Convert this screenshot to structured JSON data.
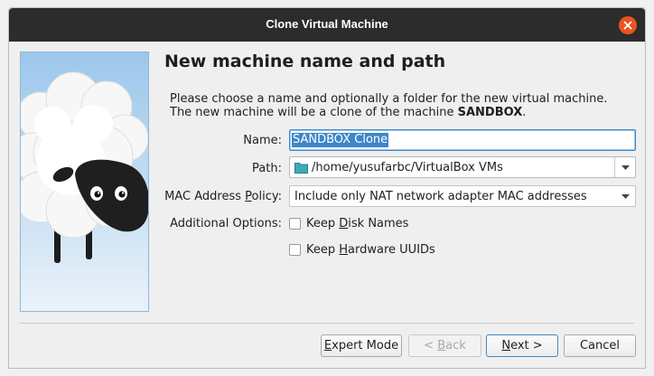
{
  "window": {
    "title": "Clone Virtual Machine"
  },
  "page": {
    "heading": "New machine name and path",
    "description_line1": "Please choose a name and optionally a folder for the new virtual machine.",
    "description_line2_prefix": "The new machine will be a clone of the machine ",
    "source_machine": "SANDBOX",
    "description_line2_suffix": "."
  },
  "form": {
    "name_label": "Name:",
    "name_value": "SANDBOX Clone",
    "path_label": "Path:",
    "path_value": "/home/yusufarbc/VirtualBox VMs",
    "mac_label_pre": "MAC Address ",
    "mac_label_accel": "P",
    "mac_label_post": "olicy:",
    "mac_value": "Include only NAT network adapter MAC addresses",
    "additional_label": "Additional Options:",
    "keep_disk_pre": "Keep ",
    "keep_disk_accel": "D",
    "keep_disk_post": "isk Names",
    "keep_disk_checked": false,
    "keep_hw_pre": "Keep ",
    "keep_hw_accel": "H",
    "keep_hw_post": "ardware UUIDs",
    "keep_hw_checked": false
  },
  "buttons": {
    "expert_accel": "E",
    "expert_rest": "xpert Mode",
    "back_pre": "< ",
    "back_accel": "B",
    "back_post": "ack",
    "next_accel": "N",
    "next_post": "ext >",
    "cancel": "Cancel"
  },
  "icons": {
    "close": "close-icon",
    "folder": "folder-icon",
    "dropdown": "chevron-down-icon",
    "illustration": "sheep-illustration"
  },
  "colors": {
    "titlebar": "#2c2c2c",
    "close": "#e95420",
    "selection": "#3d87c8",
    "focus": "#3d8bcd"
  }
}
